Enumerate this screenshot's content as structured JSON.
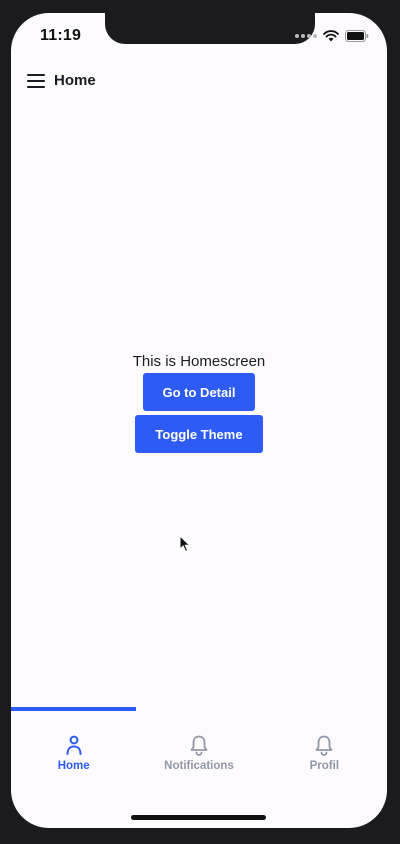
{
  "status_bar": {
    "time": "11:19"
  },
  "app_bar": {
    "title": "Home",
    "menu_icon": "hamburger-menu-icon"
  },
  "main": {
    "message": "This is Homescreen",
    "detail_button_label": "Go to Detail",
    "theme_button_label": "Toggle Theme"
  },
  "tabs": [
    {
      "label": "Home",
      "icon": "person-icon",
      "active": true
    },
    {
      "label": "Notifications",
      "icon": "bell-icon",
      "active": false
    },
    {
      "label": "Profil",
      "icon": "bell-icon",
      "active": false
    }
  ],
  "colors": {
    "accent": "#2e5bf4",
    "background": "#fdfbfe",
    "inactive_tab": "#9297a8",
    "text": "#1b1b24"
  }
}
